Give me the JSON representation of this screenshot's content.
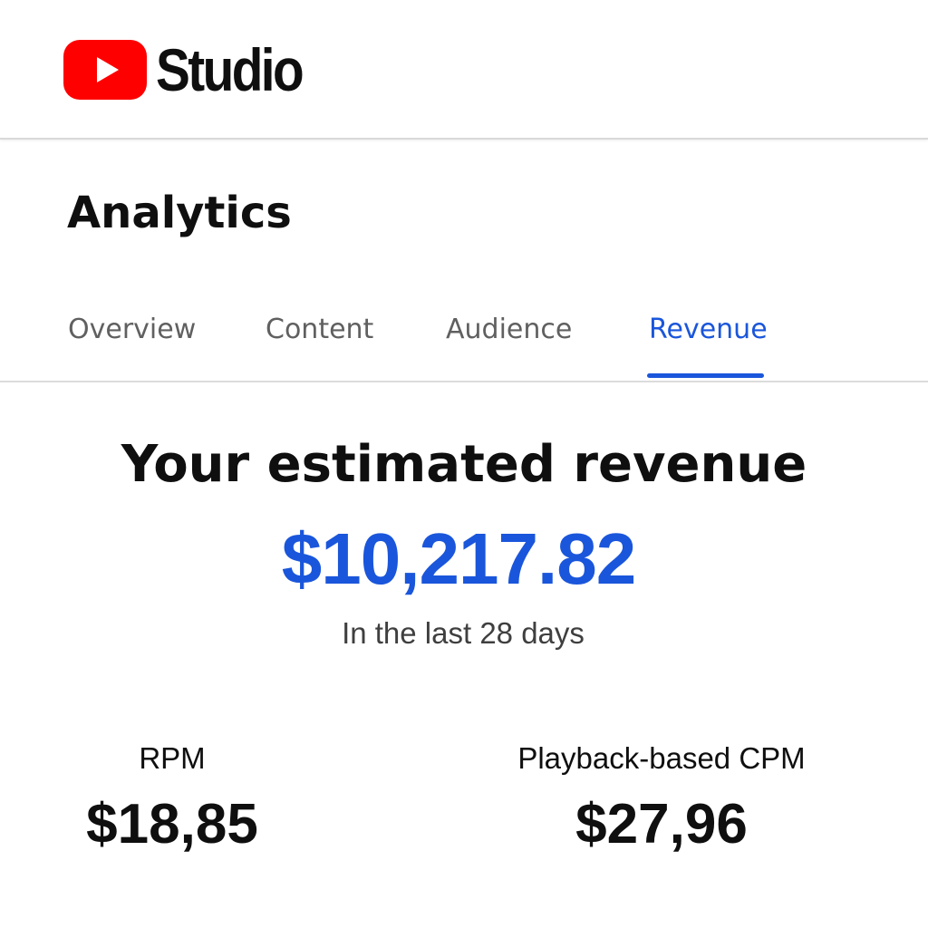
{
  "header": {
    "logo_text": "Studio",
    "logo_icon": "youtube-play-icon",
    "brand_color": "#ff0000"
  },
  "page": {
    "title": "Analytics"
  },
  "tabs": [
    {
      "label": "Overview",
      "active": false
    },
    {
      "label": "Content",
      "active": false
    },
    {
      "label": "Audience",
      "active": false
    },
    {
      "label": "Revenue",
      "active": true
    }
  ],
  "accent_color": "#1a56db",
  "revenue": {
    "headline": "Your estimated revenue",
    "amount": "$10,217.82",
    "period": "In the last 28 days"
  },
  "metrics": {
    "rpm": {
      "label": "RPM",
      "value": "$18,85"
    },
    "cpm": {
      "label": "Playback-based CPM",
      "value": "$27,96"
    }
  }
}
